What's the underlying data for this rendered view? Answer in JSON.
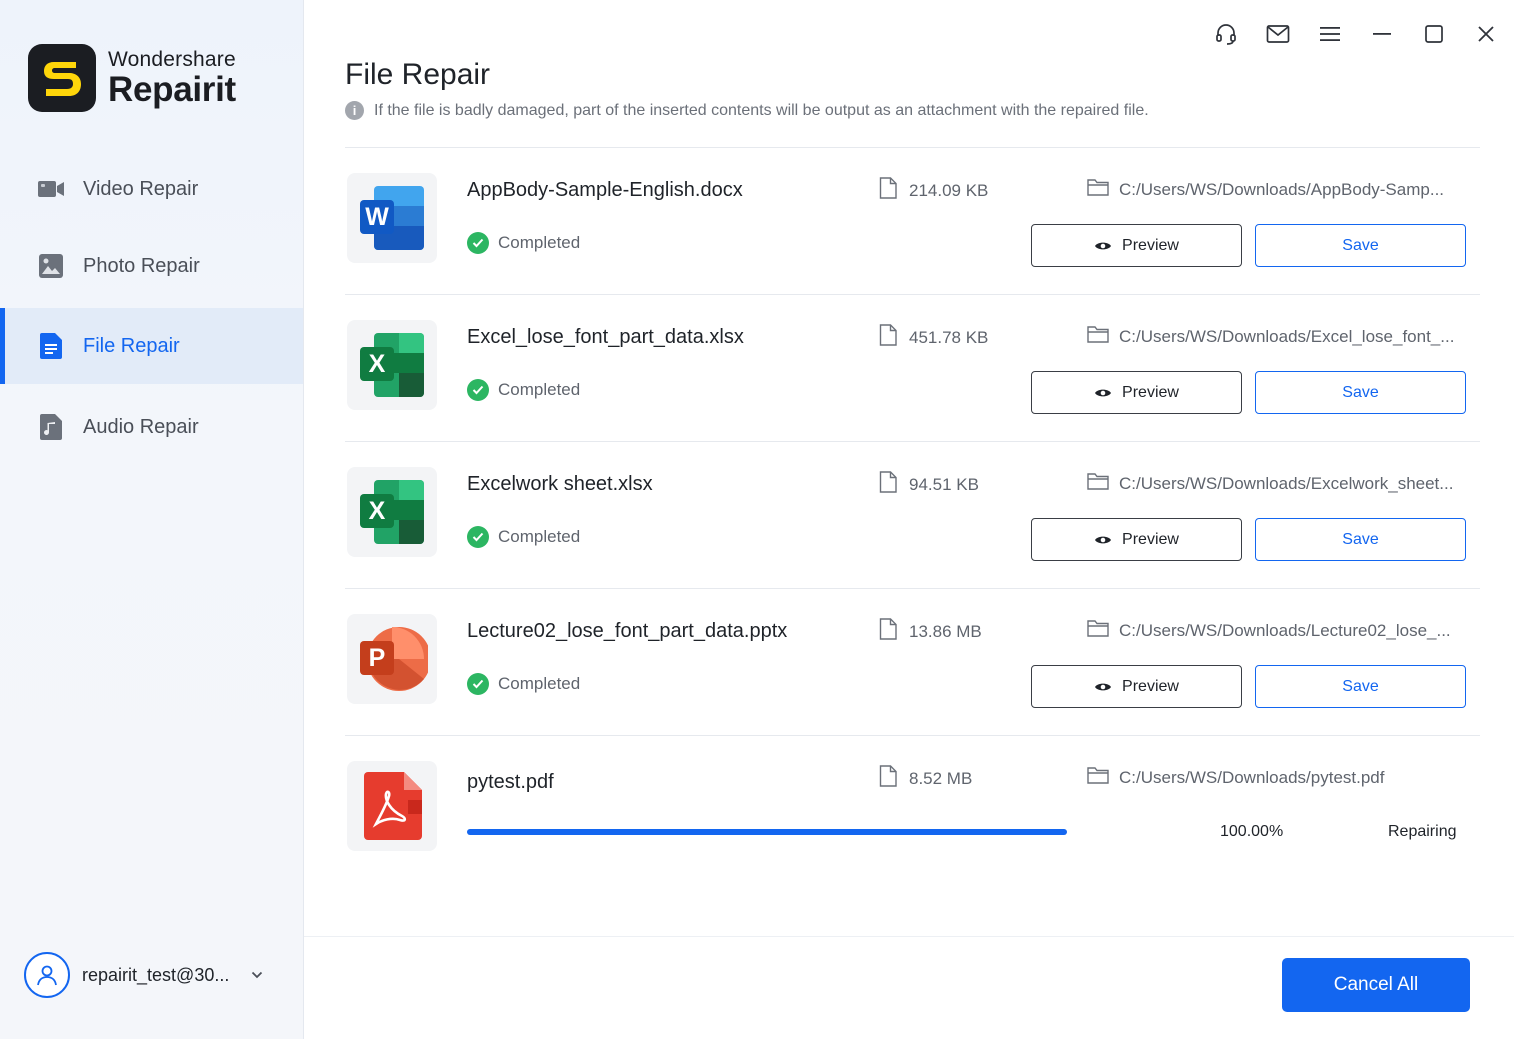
{
  "brand": {
    "top": "Wondershare",
    "bottom": "Repairit",
    "logo_icon": "repairit-s-logo",
    "logo_color": "#FFD60A"
  },
  "sidebar": {
    "items": [
      {
        "label": "Video Repair",
        "icon": "video-icon",
        "active": false
      },
      {
        "label": "Photo Repair",
        "icon": "photo-icon",
        "active": false
      },
      {
        "label": "File Repair",
        "icon": "document-icon",
        "active": true
      },
      {
        "label": "Audio Repair",
        "icon": "music-file-icon",
        "active": false
      }
    ],
    "user": {
      "name": "repairit_test@30..."
    }
  },
  "window_controls": [
    "headset-icon",
    "mail-icon",
    "menu-icon",
    "minimize-icon",
    "maximize-icon",
    "close-icon"
  ],
  "main": {
    "title": "File Repair",
    "info": "If the file is badly damaged, part of the inserted contents will be output as an attachment with the repaired file.",
    "files": [
      {
        "name": "AppBody-Sample-English.docx",
        "type": "word",
        "size": "214.09  KB",
        "path": "C:/Users/WS/Downloads/AppBody-Samp...",
        "status": "Completed",
        "preview_label": "Preview",
        "save_label": "Save"
      },
      {
        "name": "Excel_lose_font_part_data.xlsx",
        "type": "excel",
        "size": "451.78  KB",
        "path": "C:/Users/WS/Downloads/Excel_lose_font_...",
        "status": "Completed",
        "preview_label": "Preview",
        "save_label": "Save"
      },
      {
        "name": "Excelwork sheet.xlsx",
        "type": "excel",
        "size": "94.51  KB",
        "path": "C:/Users/WS/Downloads/Excelwork_sheet...",
        "status": "Completed",
        "preview_label": "Preview",
        "save_label": "Save"
      },
      {
        "name": "Lecture02_lose_font_part_data.pptx",
        "type": "powerpoint",
        "size": "13.86  MB",
        "path": "C:/Users/WS/Downloads/Lecture02_lose_...",
        "status": "Completed",
        "preview_label": "Preview",
        "save_label": "Save"
      },
      {
        "name": "pytest.pdf",
        "type": "pdf",
        "size": "8.52  MB",
        "path": "C:/Users/WS/Downloads/pytest.pdf",
        "progress_text": "100.00%",
        "progress": 1.0,
        "status": "Repairing"
      }
    ]
  },
  "footer": {
    "cancel_all_label": "Cancel All"
  },
  "colors": {
    "accent": "#1366F0",
    "success": "#2CB662",
    "word": "#185ABD",
    "excel": "#107C41",
    "powerpoint": "#D35230",
    "pdf": "#E63C2E"
  }
}
